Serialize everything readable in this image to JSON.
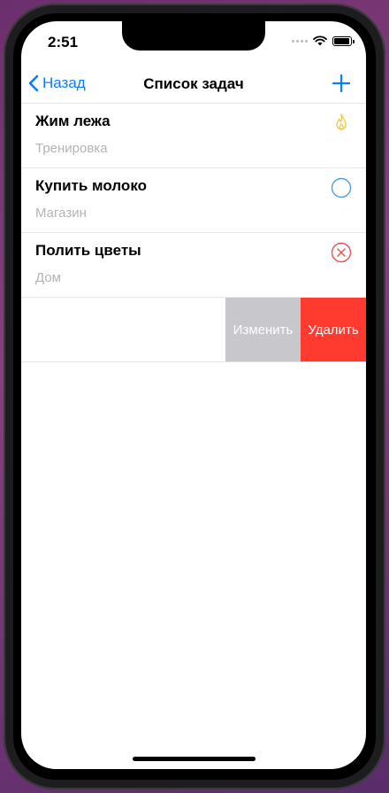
{
  "status_bar": {
    "time": "2:51"
  },
  "nav": {
    "back_label": "Назад",
    "title": "Список задач"
  },
  "tasks": [
    {
      "title": "Жим лежа",
      "category": "Тренировка",
      "icon": "flame-icon",
      "color": "#f2c94c"
    },
    {
      "title": "Купить молоко",
      "category": "Магазин",
      "icon": "circle-icon",
      "color": "#4a9fe0"
    },
    {
      "title": "Полить цветы",
      "category": "Дом",
      "icon": "x-circle-icon",
      "color": "#e8504d"
    },
    {
      "title": "",
      "category": "",
      "icon": "check-circle-icon",
      "color": "#34c759"
    }
  ],
  "swipe_actions": {
    "edit_label": "Изменить",
    "delete_label": "Удалить"
  },
  "colors": {
    "accent": "#0a7cff",
    "delete": "#ff3b30",
    "edit": "#c7c7cc"
  }
}
